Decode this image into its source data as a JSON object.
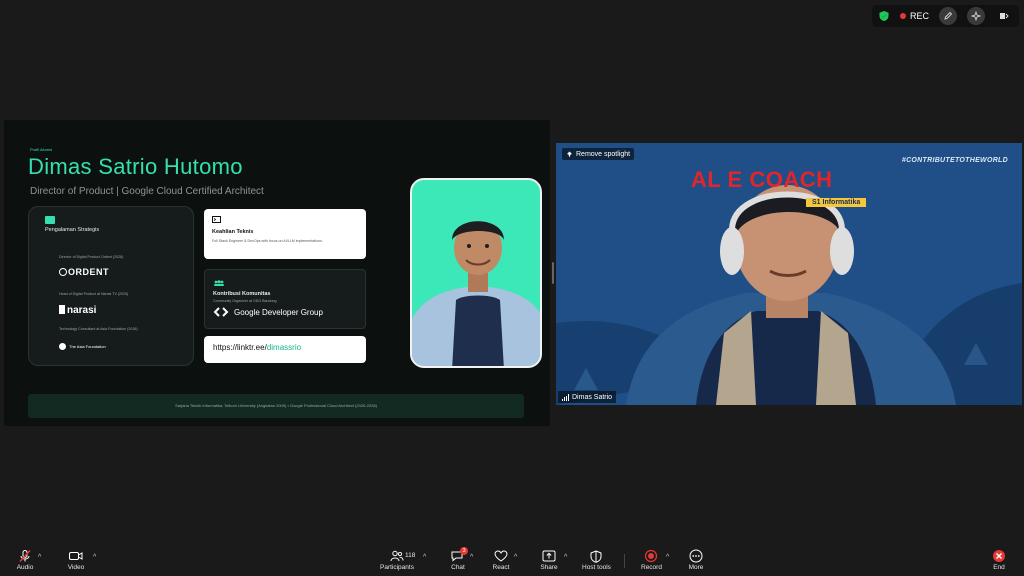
{
  "status": {
    "rec_label": "REC"
  },
  "slide": {
    "eyebrow": "Profil Alumni",
    "name": "Dimas Satrio Hutomo",
    "role": "Director of Product | Google Cloud Certified Architect",
    "experience": {
      "title": "Pengalaman Strategis",
      "items": [
        {
          "text": "Director of Digital Product Ordent (2028)",
          "logo": "ORDENT"
        },
        {
          "text": "Head of Digital Product at Narasi TV (2025)",
          "logo": "narasi"
        },
        {
          "text": "Technology Consultant at Asia Foundation (2018)",
          "logo": "The Asia Foundation"
        }
      ]
    },
    "skills": {
      "title": "Keahlian Teknis",
      "text": "Full Stack Engineer  & DevOps with focus on AI/LLM implementations."
    },
    "community": {
      "title": "Kontribusi Komunitas",
      "text": "Community Organizer at GDG Bandung",
      "logo": "Google Developer Group"
    },
    "link": {
      "prefix": "https://linktr.ee/",
      "handle": "dimassrio"
    },
    "footer": "Sarjana Teknik Informatika, Telkom University (Angkatan 2009) • Google Professional Cloud Architect (2026-2028)"
  },
  "video": {
    "spotlight_label": "Remove spotlight",
    "hashtag": "#CONTRIBUTETOTHEWORLD",
    "banner": "AL      E COACH",
    "banner_sub": "S1 Informatika",
    "participant_name": "Dimas Satrio"
  },
  "toolbar": {
    "audio": "Audio",
    "video": "Video",
    "participants": "Participants",
    "participants_count": "118",
    "chat": "Chat",
    "chat_badge": "3",
    "react": "React",
    "share": "Share",
    "host_tools": "Host tools",
    "record": "Record",
    "more": "More",
    "end": "End"
  },
  "colors": {
    "accent": "#35e0b0",
    "record": "#e53935",
    "background": "#1a1a1a"
  }
}
